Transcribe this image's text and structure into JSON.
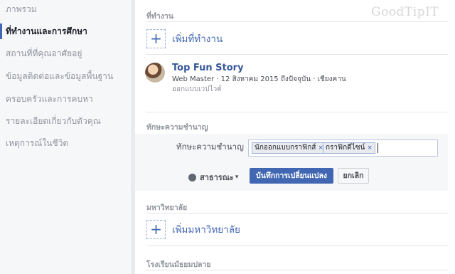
{
  "sidebar": {
    "items": [
      {
        "label": "ภาพรวม"
      },
      {
        "label": "ที่ทำงานและการศึกษา"
      },
      {
        "label": "สถานที่ที่คุณอาศัยอยู่"
      },
      {
        "label": "ข้อมูลติดต่อและข้อมูลพื้นฐาน"
      },
      {
        "label": "ครอบครัวและการคบหา"
      },
      {
        "label": "รายละเอียดเกี่ยวกับตัวคุณ"
      },
      {
        "label": "เหตุการณ์ในชีวิต"
      }
    ]
  },
  "work": {
    "heading": "ที่ทำงาน",
    "add_label": "เพิ่มที่ทำงาน",
    "item": {
      "title": "Top Fun Story",
      "subtitle": "Web Master · 12 สิงหาคม 2015 ถึงปัจจุบัน · เชียงคาน",
      "detail": "ออกแบบเวปไวต์"
    }
  },
  "skills": {
    "heading": "ทักษะความชำนาญ",
    "field_label": "ทักษะความชำนาญ",
    "tags": [
      "นักออกแบบกราฟิกส์",
      "กราฟิกดีไซน์"
    ],
    "remove_glyph": "×",
    "privacy": "สาธารณะ",
    "privacy_caret": "▾",
    "save_label": "บันทึกการเปลี่ยนแปลง",
    "cancel_label": "ยกเลิก"
  },
  "college": {
    "heading": "มหาวิทยาลัย",
    "add_label": "เพิ่มมหาวิทยาลัย"
  },
  "highschool": {
    "heading": "โรงเรียนมัธยมปลาย"
  },
  "plus_glyph": "+",
  "watermark": "GoodTipIT",
  "colors": {
    "accent": "#4267b2",
    "link": "#365899",
    "muted": "#90949c"
  }
}
